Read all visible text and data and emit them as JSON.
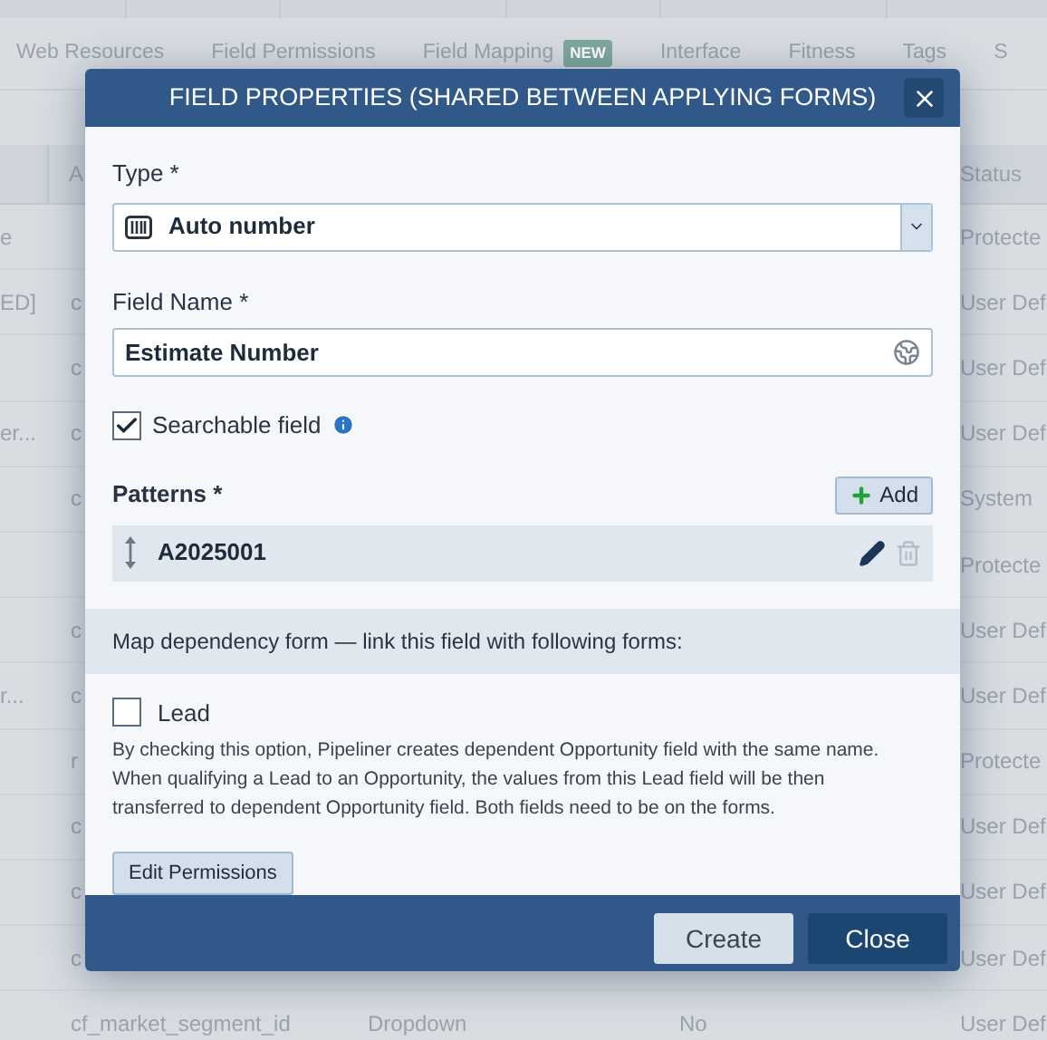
{
  "nav_tabs": [
    {
      "label": "Web Resources"
    },
    {
      "label": "Field Permissions"
    },
    {
      "label": "Field Mapping",
      "badge": "NEW"
    },
    {
      "label": "Interface"
    },
    {
      "label": "Fitness"
    },
    {
      "label": "Tags"
    },
    {
      "label": "S"
    }
  ],
  "table": {
    "header": {
      "column_2": "A",
      "status": "Status"
    },
    "rows": [
      {
        "column_1": "e",
        "status": "Protecte"
      },
      {
        "column_1": "ED]",
        "column_2": "c",
        "status": "User Def"
      },
      {
        "column_2": "c",
        "status": "User Def"
      },
      {
        "column_1": "er...",
        "column_2": "c",
        "status": "User Def"
      },
      {
        "column_2": "c",
        "status": "System"
      },
      {
        "status": "Protecte"
      },
      {
        "column_2": "c",
        "status": "User Def"
      },
      {
        "column_1": "r...",
        "column_2": "c",
        "status": "User Def"
      },
      {
        "column_2": "r",
        "status": "Protecte"
      },
      {
        "column_2": "c",
        "status": "User Def"
      },
      {
        "column_2": "c",
        "status": "User Def"
      },
      {
        "column_2": "c",
        "status": "User Def"
      },
      {
        "column_2": "cf_market_segment_id",
        "column_3": "Dropdown",
        "column_4": "No",
        "status": "User Def"
      }
    ]
  },
  "dialog": {
    "title": "FIELD PROPERTIES (SHARED BETWEEN APPLYING FORMS)",
    "type": {
      "label": "Type *",
      "value": "Auto number"
    },
    "field_name": {
      "label": "Field Name *",
      "value": "Estimate Number"
    },
    "searchable": {
      "label": "Searchable field",
      "checked": true
    },
    "patterns": {
      "label": "Patterns *",
      "add_button": "Add",
      "items": [
        "A2025001"
      ]
    },
    "dependency": {
      "heading": "Map dependency form — link this field with following forms:",
      "forms": [
        {
          "label": "Lead",
          "checked": false
        }
      ],
      "note": "By checking this option, Pipeliner creates dependent Opportunity field with the same name. When qualifying a Lead to an Opportunity, the values from this Lead field will be then transferred to dependent Opportunity field. Both fields need to be on the forms."
    },
    "edit_permissions_button": "Edit Permissions",
    "buttons": [
      {
        "label": "Create",
        "kind": "secondary"
      },
      {
        "label": "Close",
        "kind": "primary"
      }
    ]
  }
}
